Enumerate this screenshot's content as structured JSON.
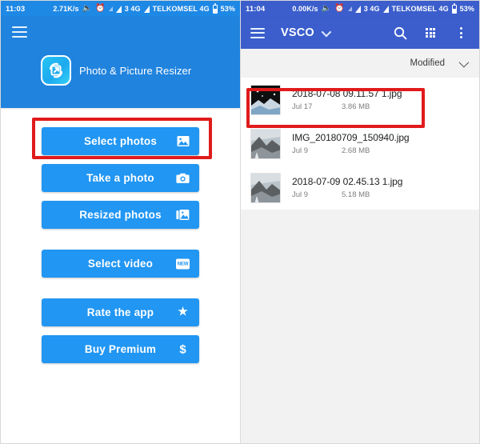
{
  "left": {
    "statusbar": {
      "time": "11:03",
      "net_speed": "2.71K/s",
      "speaker_icon": "speaker-icon",
      "alarm_icon": "alarm-icon",
      "signal_icon": "signal-icon",
      "sim1_label": "3 4G",
      "carrier": "TELKOMSEL 4G",
      "battery": "53%"
    },
    "header": {
      "menu_icon": "hamburger-menu-icon",
      "app_icon": "photo-resizer-app-icon",
      "app_title": "Photo & Picture Resizer"
    },
    "buttons": [
      {
        "label": "Select photos",
        "icon": "image-icon",
        "name": "select-photos-button",
        "highlighted": true
      },
      {
        "label": "Take a photo",
        "icon": "camera-icon",
        "name": "take-a-photo-button",
        "highlighted": false
      },
      {
        "label": "Resized photos",
        "icon": "gallery-icon",
        "name": "resized-photos-button",
        "highlighted": false
      },
      {
        "label": "Select video",
        "icon": "new-badge-icon",
        "icon_text": "NEW",
        "name": "select-video-button",
        "highlighted": false
      },
      {
        "label": "Rate the app",
        "icon": "star-icon",
        "name": "rate-the-app-button",
        "highlighted": false
      },
      {
        "label": "Buy Premium",
        "icon": "dollar-icon",
        "name": "buy-premium-button",
        "highlighted": false
      }
    ]
  },
  "right": {
    "statusbar": {
      "time": "11:04",
      "net_speed": "0.00K/s",
      "speaker_icon": "speaker-icon",
      "alarm_icon": "alarm-icon",
      "signal_icon": "signal-icon",
      "sim1_label": "3 4G",
      "carrier": "TELKOMSEL 4G",
      "battery": "53%"
    },
    "toolbar": {
      "menu_icon": "hamburger-menu-icon",
      "title": "VSCO",
      "dropdown_icon": "chevron-down-icon",
      "search_icon": "search-icon",
      "grid_icon": "grid-view-icon",
      "overflow_icon": "overflow-menu-icon"
    },
    "sort": {
      "label": "Modified",
      "chevron_icon": "chevron-down-icon"
    },
    "files": [
      {
        "name": "2018-07-08 09.11.57 1.jpg",
        "date": "Jul 17",
        "size": "3.86 MB",
        "thumb": "photo-thumbnail",
        "highlighted": true
      },
      {
        "name": "IMG_20180709_150940.jpg",
        "date": "Jul 9",
        "size": "2.68 MB",
        "thumb": "photo-thumbnail",
        "highlighted": false
      },
      {
        "name": "2018-07-09 02.45.13 1.jpg",
        "date": "Jul 9",
        "size": "5.18 MB",
        "thumb": "photo-thumbnail",
        "highlighted": false
      }
    ]
  },
  "colors": {
    "left_header_blue": "#2083de",
    "button_blue": "#2196f3",
    "vsco_toolbar_blue": "#3b5ecc",
    "highlight_red": "#e01b1b",
    "right_background": "#f2f2f2"
  }
}
